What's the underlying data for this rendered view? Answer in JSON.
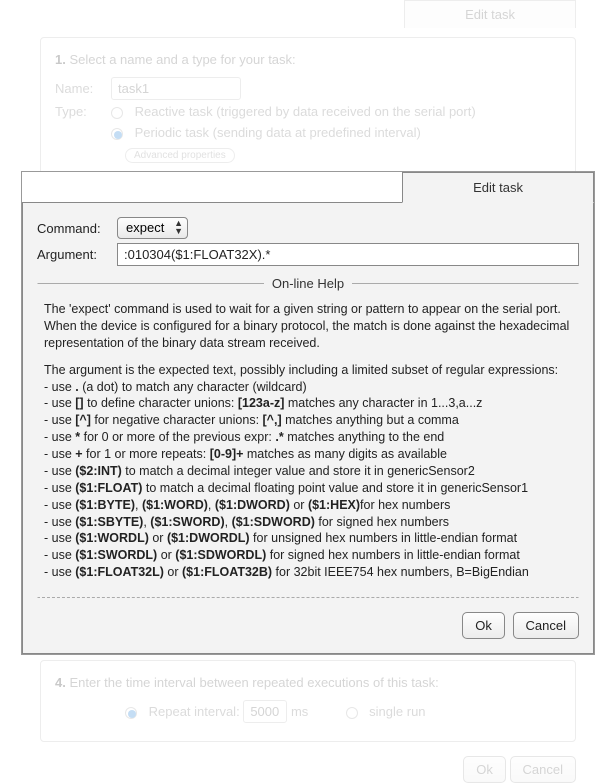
{
  "background": {
    "tab_label": "Edit task",
    "step1": {
      "title_num": "1.",
      "title_text": "Select a name and a type for your task:",
      "name_label": "Name:",
      "name_value": "task1",
      "type_label": "Type:",
      "radio1": "Reactive task (triggered by data received on the serial port)",
      "radio2": "Periodic task (sending data at predefined interval)",
      "advanced": "Advanced properties"
    },
    "step4": {
      "title_num": "4.",
      "title_text": "Enter the time interval between repeated executions of this task:",
      "repeat_label": "Repeat interval:",
      "repeat_value": "5000",
      "repeat_unit": "ms",
      "single_label": "single run"
    },
    "ok": "Ok",
    "cancel": "Cancel"
  },
  "modal": {
    "tab_label": "Edit task",
    "command_label": "Command:",
    "command_value": "expect",
    "argument_label": "Argument:",
    "argument_value": ":010304($1:FLOAT32X).*",
    "help_legend": "On-line Help",
    "help": {
      "p1": "The 'expect' command is used to wait for a given string or pattern to appear on the serial port. When the device is configured for a binary protocol, the match is done against the hexadecimal representation of the binary data stream received.",
      "p2": "The argument is the expected text, possibly including a limited subset of regular expressions:",
      "l1a": "- use ",
      "l1b": ".",
      "l1c": " (a dot) to match any character (wildcard)",
      "l2a": "- use ",
      "l2b": "[]",
      "l2c": " to define character unions: ",
      "l2d": "[123a-z]",
      "l2e": " matches any character in 1...3,a...z",
      "l3a": "- use ",
      "l3b": "[^]",
      "l3c": " for negative character unions: ",
      "l3d": "[^,]",
      "l3e": " matches anything but a comma",
      "l4a": "- use ",
      "l4b": "*",
      "l4c": " for 0 or more of the previous expr: ",
      "l4d": ".*",
      "l4e": " matches anything to the end",
      "l5a": "- use ",
      "l5b": "+",
      "l5c": " for 1 or more repeats: ",
      "l5d": "[0-9]+",
      "l5e": " matches as many digits as available",
      "l6a": "- use ",
      "l6b": "($2:INT)",
      "l6c": " to match a decimal integer value and store it in genericSensor2",
      "l7a": "- use ",
      "l7b": "($1:FLOAT)",
      "l7c": " to match a decimal floating point value and store it in genericSensor1",
      "l8a": "- use ",
      "l8b": "($1:BYTE)",
      "l8c": ", ",
      "l8d": "($1:WORD)",
      "l8e": ", ",
      "l8f": "($1:DWORD)",
      "l8g": " or ",
      "l8h": "($1:HEX)",
      "l8i": "for hex numbers",
      "l9a": "- use ",
      "l9b": "($1:SBYTE)",
      "l9c": ", ",
      "l9d": "($1:SWORD)",
      "l9e": ", ",
      "l9f": "($1:SDWORD)",
      "l9g": " for signed hex numbers",
      "l10a": "- use ",
      "l10b": "($1:WORDL)",
      "l10c": " or ",
      "l10d": "($1:DWORDL)",
      "l10e": " for unsigned hex numbers in little-endian format",
      "l11a": "- use ",
      "l11b": "($1:SWORDL)",
      "l11c": " or ",
      "l11d": "($1:SDWORDL)",
      "l11e": " for signed hex numbers in little-endian format",
      "l12a": "- use ",
      "l12b": "($1:FLOAT32L)",
      "l12c": " or ",
      "l12d": "($1:FLOAT32B)",
      "l12e": " for 32bit IEEE754 hex numbers, B=BigEndian"
    },
    "ok": "Ok",
    "cancel": "Cancel"
  }
}
